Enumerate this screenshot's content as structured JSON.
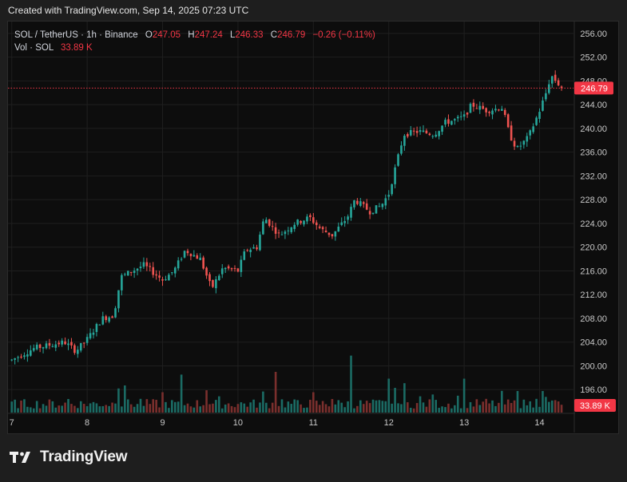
{
  "header": {
    "created_text": "Created with TradingView.com, Sep 14, 2025 07:23 UTC"
  },
  "legend": {
    "symbol": "SOL / TetherUS · 1h · Binance",
    "o_label": "O",
    "o_value": "247.05",
    "h_label": "H",
    "h_value": "247.24",
    "l_label": "L",
    "l_value": "246.33",
    "c_label": "C",
    "c_value": "246.79",
    "change": "−0.26 (−0.11%)",
    "vol_label": "Vol · SOL",
    "vol_value": "33.89 K"
  },
  "brand": {
    "name": "TradingView",
    "logo_icon": "tradingview-logo-icon"
  },
  "colors": {
    "up": "#26a69a",
    "down": "#ef5350",
    "up_vol": "#1b6b64",
    "down_vol": "#7a2f2d",
    "last_price": "#f23645",
    "grid": "#1f1f1f"
  },
  "chart_data": {
    "type": "candlestick",
    "symbol": "SOL / TetherUS",
    "interval": "1h",
    "exchange": "Binance",
    "ylim": [
      192,
      258
    ],
    "y_ticks": [
      "256.00",
      "252.00",
      "248.00",
      "244.00",
      "240.00",
      "236.00",
      "232.00",
      "228.00",
      "224.00",
      "220.00",
      "216.00",
      "212.00",
      "208.00",
      "204.00",
      "200.00",
      "196.00"
    ],
    "x_ticks": [
      "7",
      "8",
      "9",
      "10",
      "11",
      "12",
      "13",
      "14"
    ],
    "x_range_days": [
      6.95,
      14.45
    ],
    "last_price": 246.79,
    "last_price_label": "246.79",
    "volume_label": "33.89 K",
    "price_path": [
      [
        7.0,
        201.0
      ],
      [
        7.3,
        203.0
      ],
      [
        7.7,
        204.0
      ],
      [
        7.85,
        202.5
      ],
      [
        8.0,
        204.5
      ],
      [
        8.2,
        208.0
      ],
      [
        8.35,
        208.5
      ],
      [
        8.45,
        215.0
      ],
      [
        8.75,
        217.0
      ],
      [
        9.0,
        214.5
      ],
      [
        9.15,
        216.0
      ],
      [
        9.3,
        219.5
      ],
      [
        9.5,
        218.0
      ],
      [
        9.65,
        213.0
      ],
      [
        9.8,
        216.5
      ],
      [
        10.0,
        216.0
      ],
      [
        10.1,
        219.5
      ],
      [
        10.25,
        220.0
      ],
      [
        10.35,
        225.0
      ],
      [
        10.55,
        222.0
      ],
      [
        10.75,
        224.0
      ],
      [
        10.95,
        225.0
      ],
      [
        11.1,
        223.0
      ],
      [
        11.25,
        222.0
      ],
      [
        11.45,
        225.0
      ],
      [
        11.55,
        228.0
      ],
      [
        11.75,
        226.0
      ],
      [
        11.9,
        227.0
      ],
      [
        12.0,
        229.0
      ],
      [
        12.1,
        234.0
      ],
      [
        12.2,
        239.0
      ],
      [
        12.4,
        239.5
      ],
      [
        12.6,
        239.0
      ],
      [
        12.75,
        241.0
      ],
      [
        12.9,
        241.5
      ],
      [
        13.0,
        242.0
      ],
      [
        13.1,
        244.0
      ],
      [
        13.3,
        243.0
      ],
      [
        13.5,
        243.5
      ],
      [
        13.55,
        241.5
      ],
      [
        13.6,
        239.0
      ],
      [
        13.7,
        236.5
      ],
      [
        13.85,
        238.5
      ],
      [
        14.0,
        243.0
      ],
      [
        14.1,
        246.5
      ],
      [
        14.15,
        249.0
      ],
      [
        14.25,
        247.5
      ],
      [
        14.32,
        246.79
      ]
    ],
    "volume_spikes": [
      [
        7.0,
        0.08
      ],
      [
        7.2,
        0.05
      ],
      [
        7.6,
        0.06
      ],
      [
        7.75,
        0.1
      ],
      [
        7.95,
        0.08
      ],
      [
        8.1,
        0.1
      ],
      [
        8.4,
        0.4
      ],
      [
        8.5,
        0.2
      ],
      [
        8.7,
        0.14
      ],
      [
        9.0,
        0.15
      ],
      [
        9.25,
        0.28
      ],
      [
        9.6,
        0.37
      ],
      [
        9.75,
        0.12
      ],
      [
        10.1,
        0.15
      ],
      [
        10.35,
        0.35
      ],
      [
        10.5,
        0.3
      ],
      [
        10.6,
        0.22
      ],
      [
        11.0,
        0.15
      ],
      [
        11.25,
        0.1
      ],
      [
        11.5,
        0.42
      ],
      [
        11.7,
        0.12
      ],
      [
        11.9,
        0.13
      ],
      [
        12.0,
        0.25
      ],
      [
        12.1,
        0.41
      ],
      [
        12.2,
        0.3
      ],
      [
        12.4,
        0.27
      ],
      [
        12.6,
        0.3
      ],
      [
        12.9,
        0.28
      ],
      [
        13.0,
        0.25
      ],
      [
        13.3,
        0.14
      ],
      [
        13.5,
        0.16
      ],
      [
        13.7,
        0.22
      ],
      [
        13.85,
        0.12
      ],
      [
        13.95,
        0.14
      ],
      [
        14.05,
        0.22
      ],
      [
        14.1,
        0.26
      ],
      [
        14.15,
        0.2
      ],
      [
        14.3,
        0.08
      ]
    ]
  }
}
